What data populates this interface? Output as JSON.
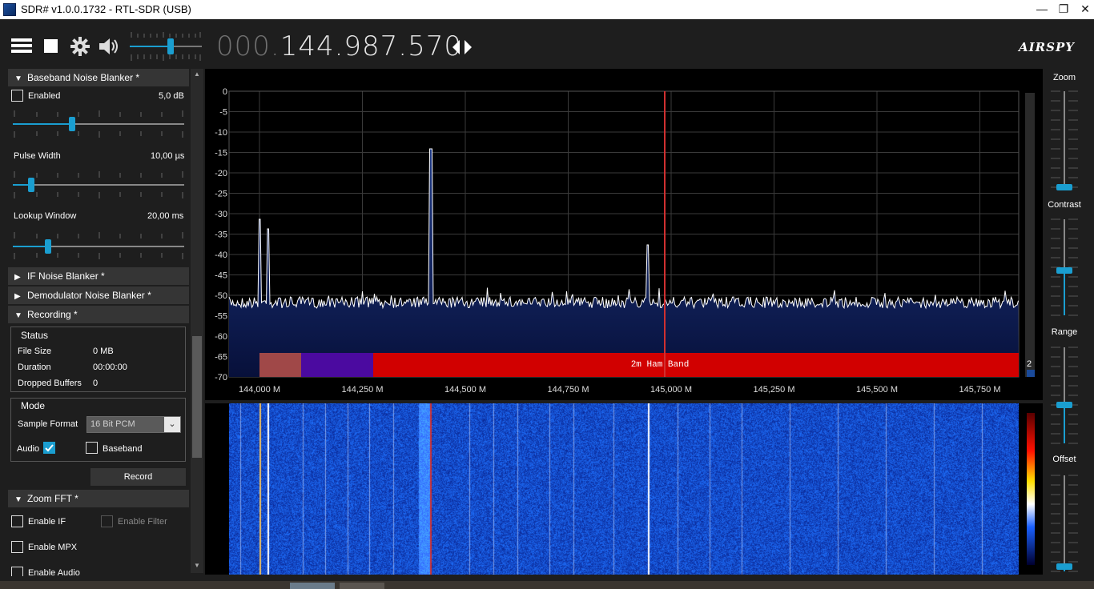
{
  "window": {
    "title": "SDR# v1.0.0.1732 - RTL-SDR (USB)",
    "minimize": "—",
    "maximize": "❐",
    "close": "✕"
  },
  "toolbar": {
    "freq_prefix": "000.",
    "freq_main": "144.987.570",
    "logo": "AIRSPY"
  },
  "sidebar": {
    "baseband_nb": {
      "title": "Baseband Noise Blanker *",
      "enabled_label": "Enabled",
      "threshold_value": "5,0 dB",
      "pulse_width_label": "Pulse Width",
      "pulse_width_value": "10,00 µs",
      "lookup_window_label": "Lookup Window",
      "lookup_window_value": "20,00 ms"
    },
    "if_nb": {
      "title": "IF Noise Blanker *"
    },
    "demod_nb": {
      "title": "Demodulator Noise Blanker *"
    },
    "recording": {
      "title": "Recording *",
      "status_title": "Status",
      "file_size_label": "File Size",
      "file_size_value": "0 MB",
      "duration_label": "Duration",
      "duration_value": "00:00:00",
      "dropped_label": "Dropped Buffers",
      "dropped_value": "0",
      "mode_title": "Mode",
      "sample_format_label": "Sample Format",
      "sample_format_value": "16 Bit PCM",
      "audio_label": "Audio",
      "baseband_label": "Baseband",
      "record_button": "Record"
    },
    "zoom_fft": {
      "title": "Zoom FFT *",
      "enable_if": "Enable IF",
      "enable_filter": "Enable Filter",
      "enable_mpx": "Enable MPX",
      "enable_audio": "Enable Audio"
    }
  },
  "spectrum": {
    "y_ticks": [
      "0",
      "-5",
      "-10",
      "-15",
      "-20",
      "-25",
      "-30",
      "-35",
      "-40",
      "-45",
      "-50",
      "-55",
      "-60",
      "-65",
      "-70"
    ],
    "x_ticks": [
      "144,000 M",
      "144,250 M",
      "144,500 M",
      "144,750 M",
      "145,000 M",
      "145,250 M",
      "145,500 M",
      "145,750 M"
    ],
    "band_label": "2m Ham Band",
    "scroll_value": "2"
  },
  "right_panel": {
    "zoom": "Zoom",
    "contrast": "Contrast",
    "range": "Range",
    "offset": "Offset"
  },
  "colors": {
    "band_red": "#d10000",
    "band_mauve": "#a04848",
    "band_purple": "#4b0aa0",
    "accent": "#1a9ed0",
    "vfo_line": "#d03030"
  }
}
